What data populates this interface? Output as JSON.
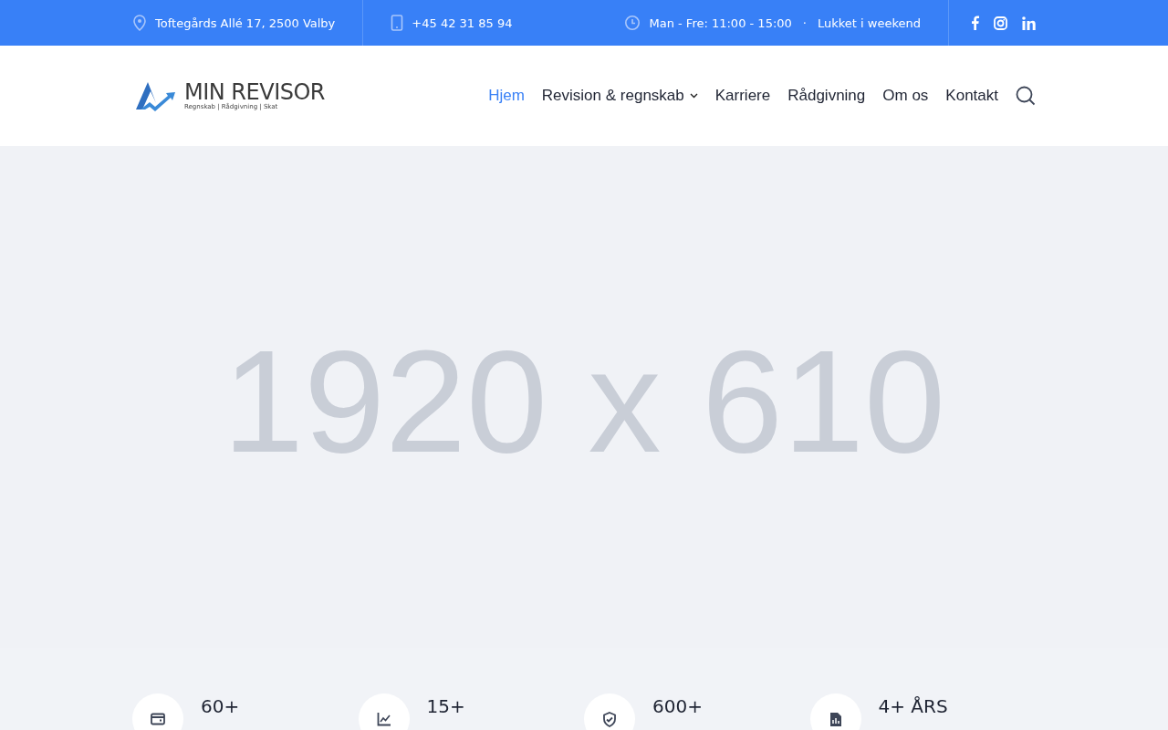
{
  "top_bar": {
    "address": "Toftegårds Allé 17, 2500 Valby",
    "phone": "+45 42 31 85 94",
    "hours": "Man - Fre: 11:00 - 15:00",
    "separator": "·",
    "closed": "Lukket i weekend"
  },
  "logo": {
    "name": "MIN REVISOR",
    "tagline": "Regnskab | Rådgivning | Skat"
  },
  "nav": [
    {
      "label": "Hjem",
      "selected": true,
      "dropdown": false
    },
    {
      "label": "Revision & regnskab",
      "selected": false,
      "dropdown": true
    },
    {
      "label": "Karriere",
      "selected": false,
      "dropdown": false
    },
    {
      "label": "Rådgivning",
      "selected": false,
      "dropdown": false
    },
    {
      "label": "Om os",
      "selected": false,
      "dropdown": false
    },
    {
      "label": "Kontakt",
      "selected": false,
      "dropdown": false
    }
  ],
  "hero": {
    "placeholder_text": "1920 x 610"
  },
  "stats": [
    {
      "kind": "wallet",
      "value": "60+"
    },
    {
      "kind": "chart",
      "value": "15+"
    },
    {
      "kind": "shield",
      "value": "600+"
    },
    {
      "kind": "report",
      "value": "4+ ÅRS"
    }
  ]
}
